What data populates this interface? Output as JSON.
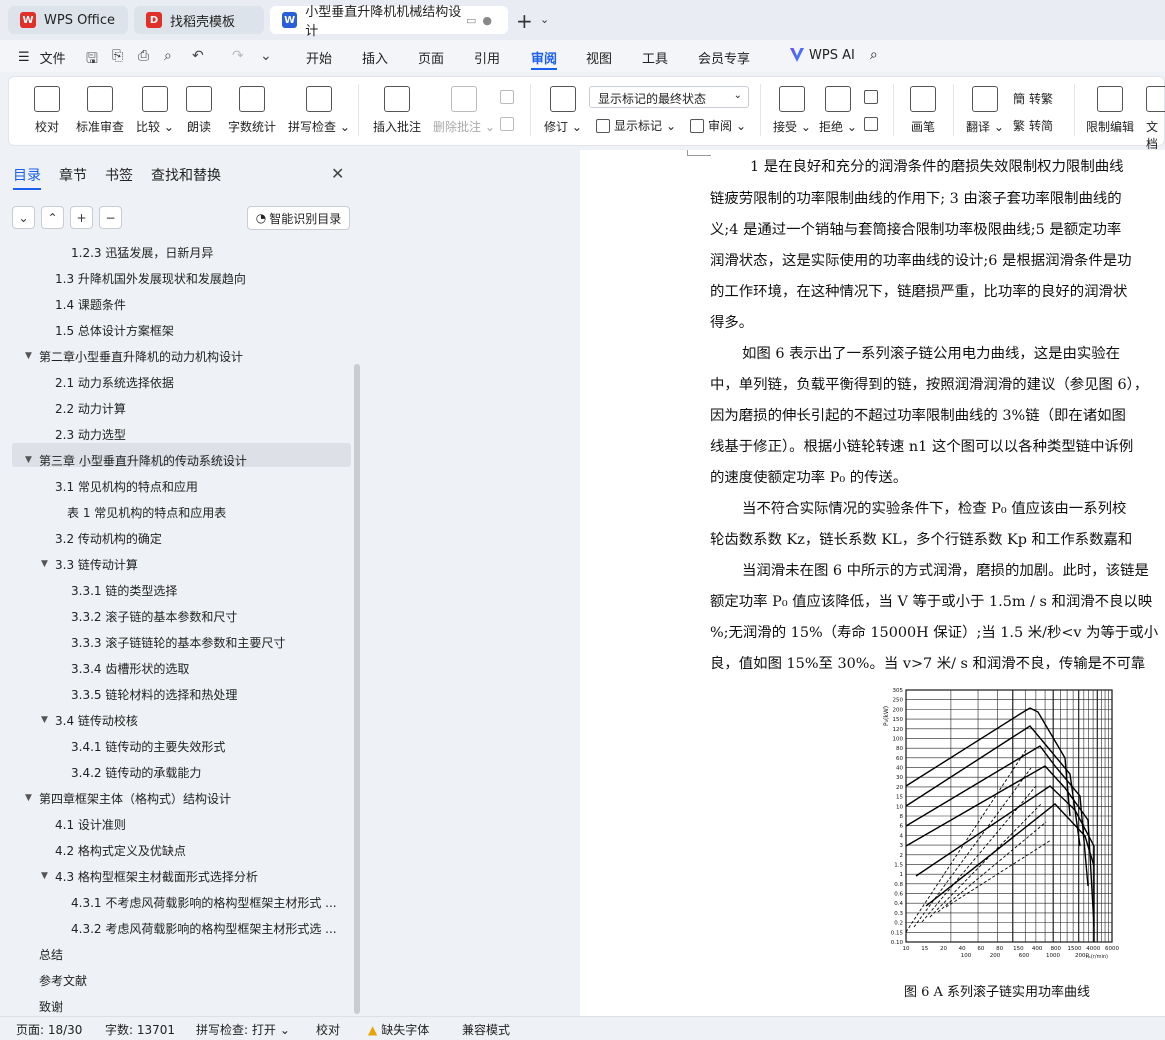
{
  "tabs": [
    {
      "label": "WPS Office",
      "icon": "wps-logo-icon",
      "color": "#e0302a"
    },
    {
      "label": "找稻壳模板",
      "icon": "docer-icon",
      "color": "#e0302a"
    },
    {
      "label": "小型垂直升降机机械结构设计",
      "icon": "word-doc-icon",
      "color": "#2b5fd9"
    }
  ],
  "menu": {
    "file": "文件",
    "items": [
      "开始",
      "插入",
      "页面",
      "引用",
      "审阅",
      "视图",
      "工具",
      "会员专享"
    ],
    "active": "审阅",
    "wps_ai": "WPS AI"
  },
  "ribbon": {
    "proofread": "校对",
    "standard_review": "标准审查",
    "compare": "比较",
    "read_aloud": "朗读",
    "word_count": "字数统计",
    "spell_check": "拼写检查",
    "insert_comment": "插入批注",
    "delete_comment": "删除批注",
    "track_changes": "修订",
    "markup_state": "显示标记的最终状态",
    "show_markup": "显示标记",
    "review_pane": "审阅",
    "accept": "接受",
    "reject": "拒绝",
    "ink": "画笔",
    "translate": "翻译",
    "to_traditional": "转繁",
    "to_simplified": "转简",
    "restrict_edit": "限制编辑",
    "doc_partial": "文档"
  },
  "nav": {
    "tabs": [
      "目录",
      "章节",
      "书签",
      "查找和替换"
    ],
    "smart_toc": "智能识别目录",
    "items": [
      {
        "text": "1.2.3  迅猛发展，日新月异",
        "level": 3
      },
      {
        "text": "1.3  升降机国外发展现状和发展趋向",
        "level": 2
      },
      {
        "text": "1.4  课题条件",
        "level": 2
      },
      {
        "text": "1.5  总体设计方案框架",
        "level": 2
      },
      {
        "text": "第二章小型垂直升降机的动力机构设计",
        "level": 1
      },
      {
        "text": "2.1  动力系统选择依据",
        "level": 2
      },
      {
        "text": "2.2  动力计算",
        "level": 2
      },
      {
        "text": "2.3  动力选型",
        "level": 2
      },
      {
        "text": "第三章  小型垂直升降机的传动系统设计",
        "level": 1
      },
      {
        "text": "3.1 常见机构的特点和应用",
        "level": 2
      },
      {
        "text": "表 1  常见机构的特点和应用表",
        "level": 3
      },
      {
        "text": "3.2  传动机构的确定",
        "level": 2
      },
      {
        "text": "3.3  链传动计算",
        "level": 2
      },
      {
        "text": "3.3.1  链的类型选择",
        "level": 3
      },
      {
        "text": "3.3.2  滚子链的基本参数和尺寸",
        "level": 3
      },
      {
        "text": "3.3.3  滚子链链轮的基本参数和主要尺寸",
        "level": 3
      },
      {
        "text": "3.3.4  齿槽形状的选取",
        "level": 3
      },
      {
        "text": "3.3.5  链轮材料的选择和热处理",
        "level": 3
      },
      {
        "text": "3.4  链传动校核",
        "level": 2
      },
      {
        "text": "3.4.1  链传动的主要失效形式",
        "level": 3
      },
      {
        "text": "3.4.2  链传动的承载能力",
        "level": 3
      },
      {
        "text": "第四章框架主体（格构式）结构设计",
        "level": 1
      },
      {
        "text": "4.1  设计准则",
        "level": 2
      },
      {
        "text": "4.2  格构式定义及优缺点",
        "level": 2
      },
      {
        "text": "4.3  格构型框架主材截面形式选择分析",
        "level": 2
      },
      {
        "text": "4.3.1  不考虑风荷载影响的格构型框架主材形式 ...",
        "level": 3
      },
      {
        "text": "4.3.2  考虑风荷载影响的格构型框架主材形式选 ...",
        "level": 3
      },
      {
        "text": "总结",
        "level": 1
      },
      {
        "text": "参考文献",
        "level": 1
      },
      {
        "text": "致谢",
        "level": 1
      }
    ]
  },
  "doc": {
    "lines": [
      "1 是在良好和充分的润滑条件的磨损失效限制权力限制曲线",
      "链疲劳限制的功率限制曲线的作用下; 3 由滚子套功率限制曲线的",
      "义;4 是通过一个销轴与套筒接合限制功率极限曲线;5 是额定功率",
      "润滑状态，这是实际使用的功率曲线的设计;6 是根据润滑条件是功",
      "的工作环境，在这种情况下，链磨损严重，比功率的良好的润滑状",
      "得多。",
      "如图 6 表示出了一系列滚子链公用电力曲线，这是由实验在",
      "中，单列链，负载平衡得到的链，按照润滑润滑的建议（参见图 6），",
      "因为磨损的伸长引起的不超过功率限制曲线的 3%链（即在诸如图",
      "线基于修正）。根据小链轮转速 n1 这个图可以以各种类型链中诉例",
      "的速度使额定功率 P₀ 的传送。",
      "当不符合实际情况的实验条件下，检查 P₀ 值应该由一系列校",
      "轮齿数系数 Kz，链长系数 KL，多个行链系数 Kp 和工作系数嘉和",
      "当润滑未在图 6 中所示的方式润滑，磨损的加剧。此时，该链是",
      "额定功率 P₀ 值应该降低，当 V 等于或小于 1.5m / s 和润滑不良以映",
      "%;无润滑的 15%（寿命 15000H 保证）;当 1.5 米/秒<v 为等于或小",
      "良，值如图 15%至 30%。当 v>7 米/ s 和润滑不良，传输是不可靠"
    ],
    "figure_caption": "图 6   A 系列滚子链实用功率曲线",
    "figure": {
      "y_ticks": [
        "305",
        "250",
        "200",
        "150",
        "120",
        "100",
        "80",
        "60",
        "40",
        "30",
        "20",
        "15",
        "10",
        "8",
        "6",
        "4",
        "3",
        "2",
        "1.5",
        "1",
        "0.8",
        "0.6",
        "0.4",
        "0.3",
        "0.2",
        "0.15",
        "0.10"
      ],
      "x_ticks_top": [
        "10",
        "15",
        "20",
        "40",
        "60",
        "80",
        "150",
        "400",
        "800",
        "1500",
        "4000",
        "6000"
      ],
      "x_ticks_bottom": [
        "100",
        "200",
        "600",
        "1000",
        "2000"
      ],
      "y_label": "P₀(kW)",
      "x_label": "n₁(r/min)"
    }
  },
  "status": {
    "page": "页面: 18/30",
    "words": "字数: 13701",
    "spell": "拼写检查: 打开",
    "proof": "校对",
    "missing_font": "缺失字体",
    "compat": "兼容模式"
  }
}
